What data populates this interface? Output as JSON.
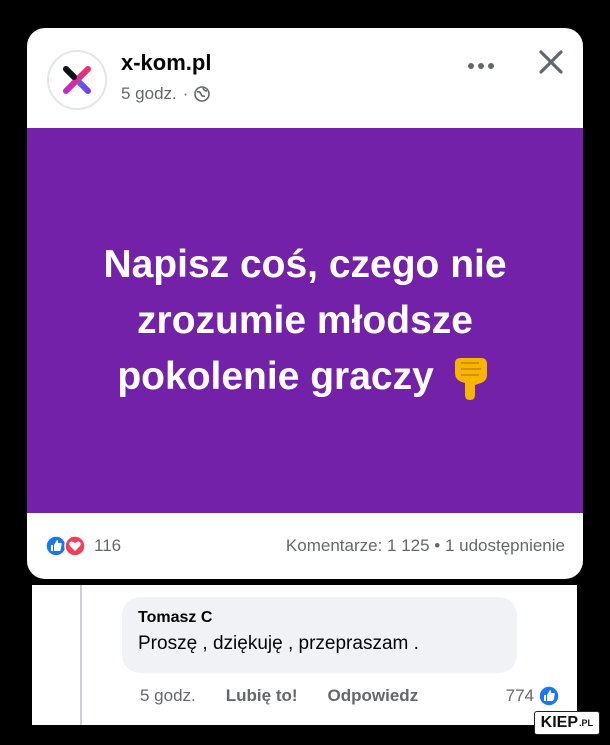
{
  "post": {
    "page_name": "x-kom.pl",
    "time": "5 godz.",
    "meta_separator": "·",
    "text_lines": [
      "Napisz coś, czego nie",
      "zrozumie młodsze",
      "pokolenie graczy"
    ],
    "background_color": "#7321a9",
    "reaction_count": "116",
    "stats": "Komentarze: 1 125 • 1 udostępnienie"
  },
  "comment": {
    "author": "Tomasz C",
    "text": "Proszę , dziękuję , przepraszam .",
    "time": "5 godz.",
    "like_label": "Lubię to!",
    "reply_label": "Odpowiedz",
    "like_count": "774"
  },
  "watermark": {
    "label": "KIEP",
    "suffix": ".PL"
  },
  "icons": {
    "globe": "globe-icon",
    "more": "more-icon",
    "close": "close-icon",
    "like": "like-reaction-icon",
    "love": "love-reaction-icon",
    "pointer": "pointing-down-emoji"
  },
  "colors": {
    "facebook_blue": "#1877f2",
    "love_red": "#f33e58",
    "emoji_yellow": "#f7b500"
  }
}
